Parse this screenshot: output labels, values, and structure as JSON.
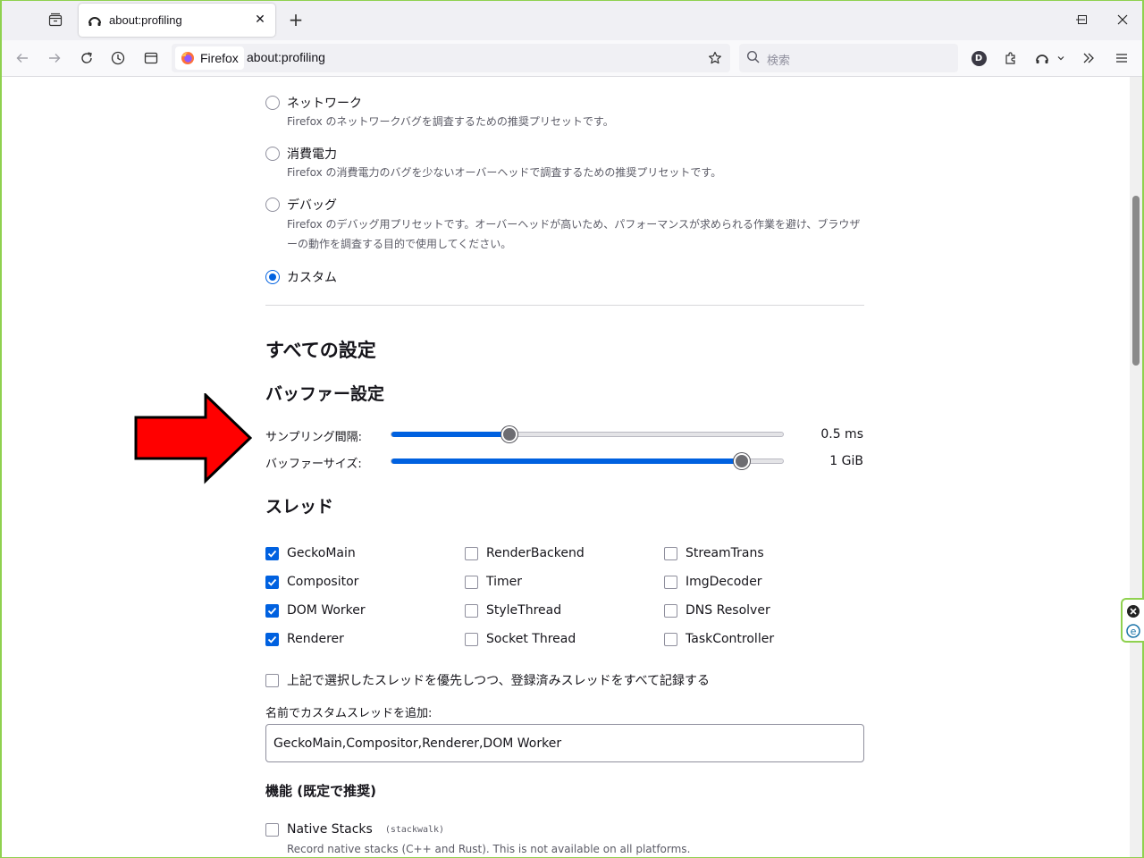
{
  "tabs": [
    {
      "title": "about:profiling"
    }
  ],
  "navbar": {
    "identity_label": "Firefox",
    "url": "about:profiling",
    "search_placeholder": "検索",
    "avatar_initial": "D"
  },
  "presets": [
    {
      "label": "ネットワーク",
      "description": "Firefox のネットワークバグを調査するための推奨プリセットです。",
      "checked": false
    },
    {
      "label": "消費電力",
      "description": "Firefox の消費電力のバグを少ないオーバーヘッドで調査するための推奨プリセットです。",
      "checked": false
    },
    {
      "label": "デバッグ",
      "description": "Firefox のデバッグ用プリセットです。オーバーヘッドが高いため、パフォーマンスが求められる作業を避け、ブラウザーの動作を調査する目的で使用してください。",
      "checked": false
    },
    {
      "label": "カスタム",
      "description": "",
      "checked": true
    }
  ],
  "all_settings_title": "すべての設定",
  "buffer": {
    "title": "バッファー設定",
    "sampling_label": "サンプリング間隔:",
    "sampling_value": "0.5 ms",
    "sampling_fraction": 0.3,
    "buffer_label": "バッファーサイズ:",
    "buffer_value": "1 GiB",
    "buffer_fraction": 0.89
  },
  "threads": {
    "title": "スレッド",
    "items": [
      {
        "label": "GeckoMain",
        "checked": true
      },
      {
        "label": "RenderBackend",
        "checked": false
      },
      {
        "label": "StreamTrans",
        "checked": false
      },
      {
        "label": "Compositor",
        "checked": true
      },
      {
        "label": "Timer",
        "checked": false
      },
      {
        "label": "ImgDecoder",
        "checked": false
      },
      {
        "label": "DOM Worker",
        "checked": true
      },
      {
        "label": "StyleThread",
        "checked": false
      },
      {
        "label": "DNS Resolver",
        "checked": false
      },
      {
        "label": "Renderer",
        "checked": true
      },
      {
        "label": "Socket Thread",
        "checked": false
      },
      {
        "label": "TaskController",
        "checked": false
      }
    ],
    "record_all_label": "上記で選択したスレッドを優先しつつ、登録済みスレッドをすべて記録する",
    "custom_label": "名前でカスタムスレッドを追加:",
    "custom_value": "GeckoMain,Compositor,Renderer,DOM Worker"
  },
  "features": {
    "title": "機能 (既定で推奨)",
    "native_stacks_label": "Native Stacks",
    "native_stacks_code": "(stackwalk)",
    "native_stacks_desc": "Record native stacks (C++ and Rust). This is not available on all platforms."
  },
  "colors": {
    "accent": "#0061e0",
    "arrow": "#ff0000",
    "frame": "#8fd14f"
  }
}
